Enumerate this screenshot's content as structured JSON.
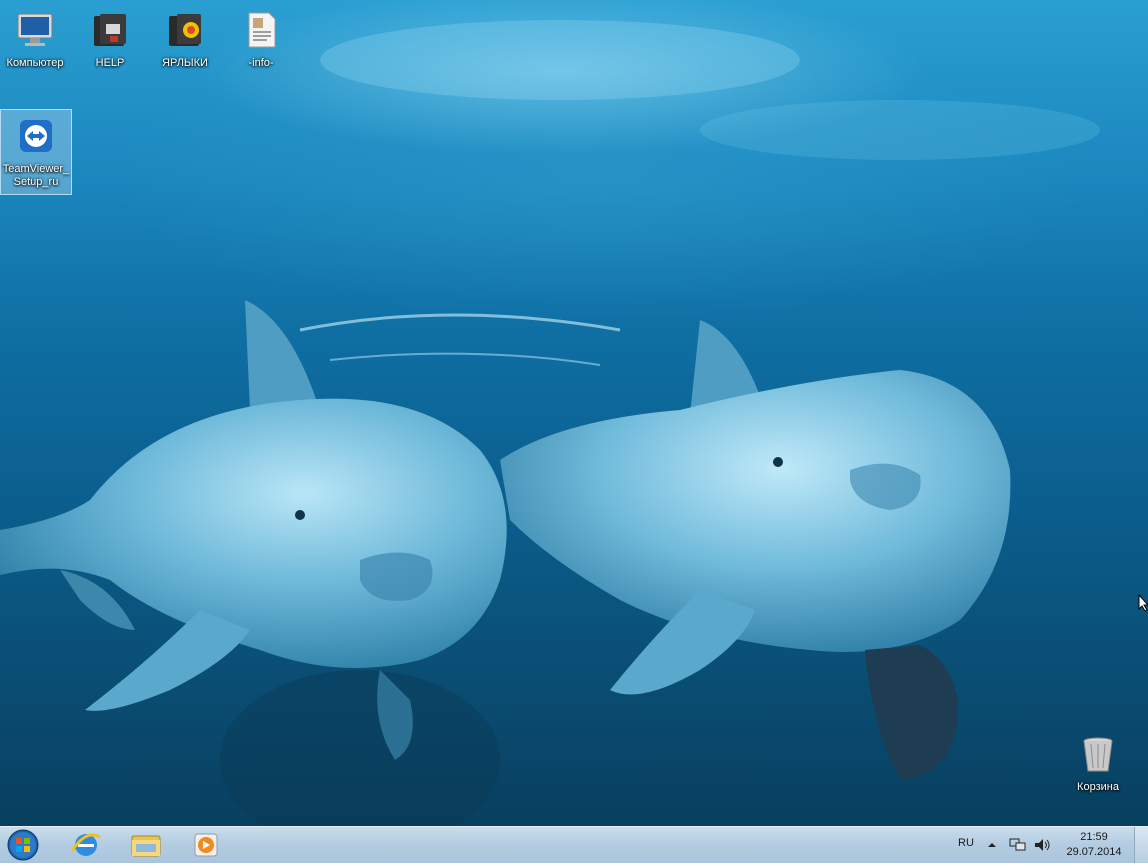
{
  "desktop": {
    "icons": [
      {
        "label": "Компьютер",
        "icon": "computer-icon"
      },
      {
        "label": "HELP",
        "icon": "folder-help-icon"
      },
      {
        "label": "ЯРЛЫКИ",
        "icon": "folder-shortcuts-icon"
      },
      {
        "label": "-info-",
        "icon": "document-icon"
      },
      {
        "label": "TeamViewer_Setup_ru",
        "icon": "teamviewer-icon"
      },
      {
        "label": "Корзина",
        "icon": "recycle-bin-icon"
      }
    ]
  },
  "taskbar": {
    "pinned": [
      {
        "icon": "start-orb-icon"
      },
      {
        "icon": "internet-explorer-icon"
      },
      {
        "icon": "windows-explorer-icon"
      },
      {
        "icon": "media-player-icon"
      }
    ],
    "tray": {
      "language": "RU",
      "time": "21:59",
      "date": "29.07.2014",
      "icons": [
        "show-hidden-icons-icon",
        "network-icon",
        "volume-icon"
      ]
    }
  },
  "colors": {
    "taskbar": "#b5cde2",
    "water_top": "#2a9fd2",
    "water_bottom": "#083f5f",
    "dolphin": "#7fc3e0"
  }
}
